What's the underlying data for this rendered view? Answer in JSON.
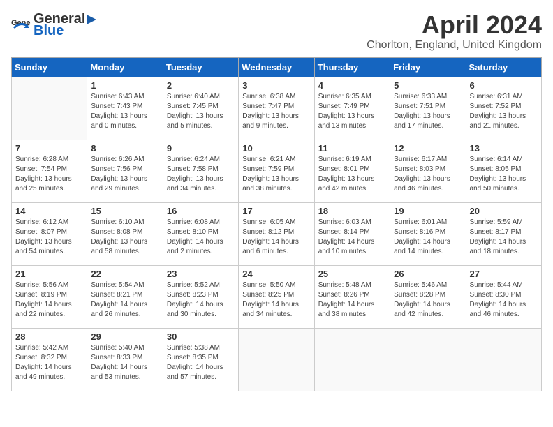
{
  "header": {
    "logo_general": "General",
    "logo_blue": "Blue",
    "month": "April 2024",
    "location": "Chorlton, England, United Kingdom"
  },
  "weekdays": [
    "Sunday",
    "Monday",
    "Tuesday",
    "Wednesday",
    "Thursday",
    "Friday",
    "Saturday"
  ],
  "weeks": [
    [
      {
        "day": "",
        "info": ""
      },
      {
        "day": "1",
        "info": "Sunrise: 6:43 AM\nSunset: 7:43 PM\nDaylight: 13 hours\nand 0 minutes."
      },
      {
        "day": "2",
        "info": "Sunrise: 6:40 AM\nSunset: 7:45 PM\nDaylight: 13 hours\nand 5 minutes."
      },
      {
        "day": "3",
        "info": "Sunrise: 6:38 AM\nSunset: 7:47 PM\nDaylight: 13 hours\nand 9 minutes."
      },
      {
        "day": "4",
        "info": "Sunrise: 6:35 AM\nSunset: 7:49 PM\nDaylight: 13 hours\nand 13 minutes."
      },
      {
        "day": "5",
        "info": "Sunrise: 6:33 AM\nSunset: 7:51 PM\nDaylight: 13 hours\nand 17 minutes."
      },
      {
        "day": "6",
        "info": "Sunrise: 6:31 AM\nSunset: 7:52 PM\nDaylight: 13 hours\nand 21 minutes."
      }
    ],
    [
      {
        "day": "7",
        "info": "Sunrise: 6:28 AM\nSunset: 7:54 PM\nDaylight: 13 hours\nand 25 minutes."
      },
      {
        "day": "8",
        "info": "Sunrise: 6:26 AM\nSunset: 7:56 PM\nDaylight: 13 hours\nand 29 minutes."
      },
      {
        "day": "9",
        "info": "Sunrise: 6:24 AM\nSunset: 7:58 PM\nDaylight: 13 hours\nand 34 minutes."
      },
      {
        "day": "10",
        "info": "Sunrise: 6:21 AM\nSunset: 7:59 PM\nDaylight: 13 hours\nand 38 minutes."
      },
      {
        "day": "11",
        "info": "Sunrise: 6:19 AM\nSunset: 8:01 PM\nDaylight: 13 hours\nand 42 minutes."
      },
      {
        "day": "12",
        "info": "Sunrise: 6:17 AM\nSunset: 8:03 PM\nDaylight: 13 hours\nand 46 minutes."
      },
      {
        "day": "13",
        "info": "Sunrise: 6:14 AM\nSunset: 8:05 PM\nDaylight: 13 hours\nand 50 minutes."
      }
    ],
    [
      {
        "day": "14",
        "info": "Sunrise: 6:12 AM\nSunset: 8:07 PM\nDaylight: 13 hours\nand 54 minutes."
      },
      {
        "day": "15",
        "info": "Sunrise: 6:10 AM\nSunset: 8:08 PM\nDaylight: 13 hours\nand 58 minutes."
      },
      {
        "day": "16",
        "info": "Sunrise: 6:08 AM\nSunset: 8:10 PM\nDaylight: 14 hours\nand 2 minutes."
      },
      {
        "day": "17",
        "info": "Sunrise: 6:05 AM\nSunset: 8:12 PM\nDaylight: 14 hours\nand 6 minutes."
      },
      {
        "day": "18",
        "info": "Sunrise: 6:03 AM\nSunset: 8:14 PM\nDaylight: 14 hours\nand 10 minutes."
      },
      {
        "day": "19",
        "info": "Sunrise: 6:01 AM\nSunset: 8:16 PM\nDaylight: 14 hours\nand 14 minutes."
      },
      {
        "day": "20",
        "info": "Sunrise: 5:59 AM\nSunset: 8:17 PM\nDaylight: 14 hours\nand 18 minutes."
      }
    ],
    [
      {
        "day": "21",
        "info": "Sunrise: 5:56 AM\nSunset: 8:19 PM\nDaylight: 14 hours\nand 22 minutes."
      },
      {
        "day": "22",
        "info": "Sunrise: 5:54 AM\nSunset: 8:21 PM\nDaylight: 14 hours\nand 26 minutes."
      },
      {
        "day": "23",
        "info": "Sunrise: 5:52 AM\nSunset: 8:23 PM\nDaylight: 14 hours\nand 30 minutes."
      },
      {
        "day": "24",
        "info": "Sunrise: 5:50 AM\nSunset: 8:25 PM\nDaylight: 14 hours\nand 34 minutes."
      },
      {
        "day": "25",
        "info": "Sunrise: 5:48 AM\nSunset: 8:26 PM\nDaylight: 14 hours\nand 38 minutes."
      },
      {
        "day": "26",
        "info": "Sunrise: 5:46 AM\nSunset: 8:28 PM\nDaylight: 14 hours\nand 42 minutes."
      },
      {
        "day": "27",
        "info": "Sunrise: 5:44 AM\nSunset: 8:30 PM\nDaylight: 14 hours\nand 46 minutes."
      }
    ],
    [
      {
        "day": "28",
        "info": "Sunrise: 5:42 AM\nSunset: 8:32 PM\nDaylight: 14 hours\nand 49 minutes."
      },
      {
        "day": "29",
        "info": "Sunrise: 5:40 AM\nSunset: 8:33 PM\nDaylight: 14 hours\nand 53 minutes."
      },
      {
        "day": "30",
        "info": "Sunrise: 5:38 AM\nSunset: 8:35 PM\nDaylight: 14 hours\nand 57 minutes."
      },
      {
        "day": "",
        "info": ""
      },
      {
        "day": "",
        "info": ""
      },
      {
        "day": "",
        "info": ""
      },
      {
        "day": "",
        "info": ""
      }
    ]
  ]
}
